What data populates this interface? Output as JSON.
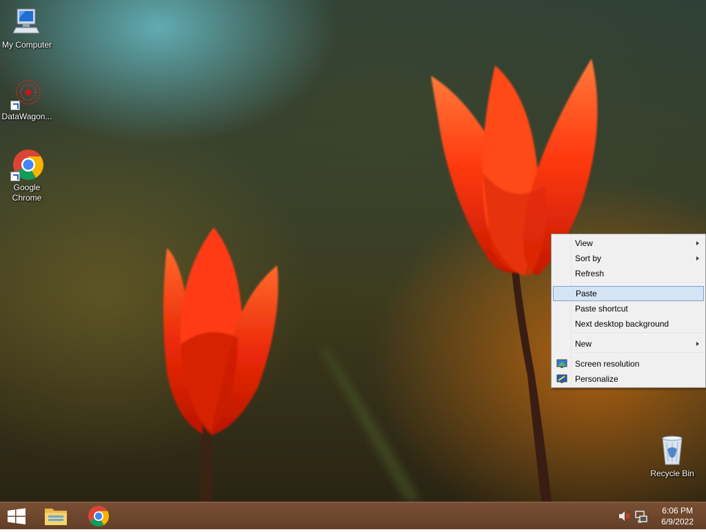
{
  "desktop": {
    "icons": [
      {
        "label": "My Computer"
      },
      {
        "label": "DataWagon..."
      },
      {
        "label": "Google\nChrome",
        "line1": "Google",
        "line2": "Chrome"
      },
      {
        "label": "Recycle Bin"
      }
    ]
  },
  "context_menu": {
    "items": [
      {
        "label": "View",
        "submenu": true
      },
      {
        "label": "Sort by",
        "submenu": true
      },
      {
        "label": "Refresh"
      },
      {
        "label": "Paste",
        "highlighted": true
      },
      {
        "label": "Paste shortcut"
      },
      {
        "label": "Next desktop background"
      },
      {
        "label": "New",
        "submenu": true
      },
      {
        "label": "Screen resolution",
        "icon": "display-icon"
      },
      {
        "label": "Personalize",
        "icon": "personalize-icon"
      }
    ]
  },
  "taskbar": {
    "pinned": [
      {
        "name": "start-button",
        "icon": "windows-logo-icon"
      },
      {
        "name": "file-explorer",
        "icon": "folder-icon"
      },
      {
        "name": "google-chrome",
        "icon": "chrome-icon"
      }
    ],
    "tray": {
      "volume_icon": "volume-muted-icon",
      "network_icon": "network-icon"
    },
    "clock": {
      "time": "6:06 PM",
      "date": "6/9/2022"
    }
  },
  "colors": {
    "menu_highlight": "#d5e4f5",
    "menu_highlight_border": "#7da2ce",
    "taskbar": "#6e4329",
    "tulip": "#ff3a10"
  }
}
